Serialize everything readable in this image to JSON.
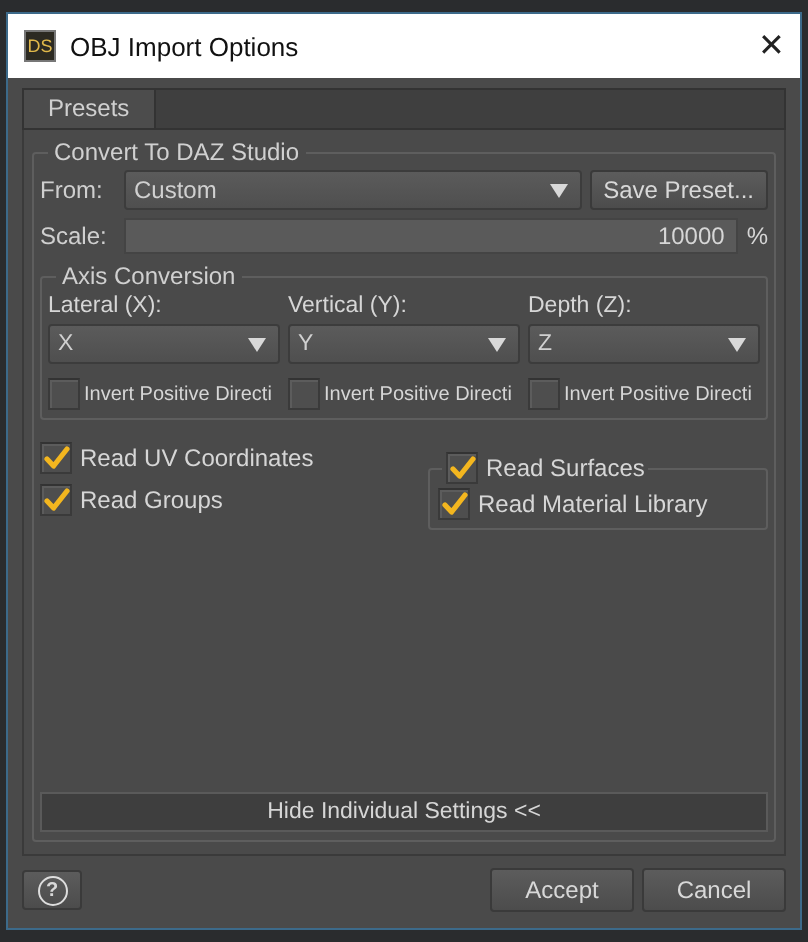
{
  "window": {
    "logo": "DS",
    "title": "OBJ Import Options",
    "close": "✕"
  },
  "tabs": [
    {
      "label": "Presets",
      "selected": true
    }
  ],
  "convert_group": {
    "title": "Convert To DAZ Studio",
    "from": {
      "label": "From:",
      "value": "Custom"
    },
    "save_preset_button": "Save Preset...",
    "scale": {
      "label": "Scale:",
      "value": "10000",
      "unit": "%"
    }
  },
  "axis_group": {
    "title": "Axis Conversion",
    "axes": [
      {
        "label": "Lateral (X):",
        "value": "X",
        "invert": {
          "label": "Invert Positive Directi",
          "checked": false
        }
      },
      {
        "label": "Vertical (Y):",
        "value": "Y",
        "invert": {
          "label": "Invert Positive Directi",
          "checked": false
        }
      },
      {
        "label": "Depth (Z):",
        "value": "Z",
        "invert": {
          "label": "Invert Positive Directi",
          "checked": false
        }
      }
    ]
  },
  "options": [
    {
      "label": "Read UV Coordinates",
      "checked": true
    },
    {
      "label": "Read Groups",
      "checked": true
    }
  ],
  "surfaces_group": {
    "label": "Read Surfaces",
    "checked": true,
    "options": [
      {
        "label": "Read Material Library",
        "checked": true
      }
    ]
  },
  "toggle_button": "Hide Individual Settings <<",
  "footer": {
    "help": "?",
    "buttons": [
      "Accept",
      "Cancel"
    ]
  }
}
